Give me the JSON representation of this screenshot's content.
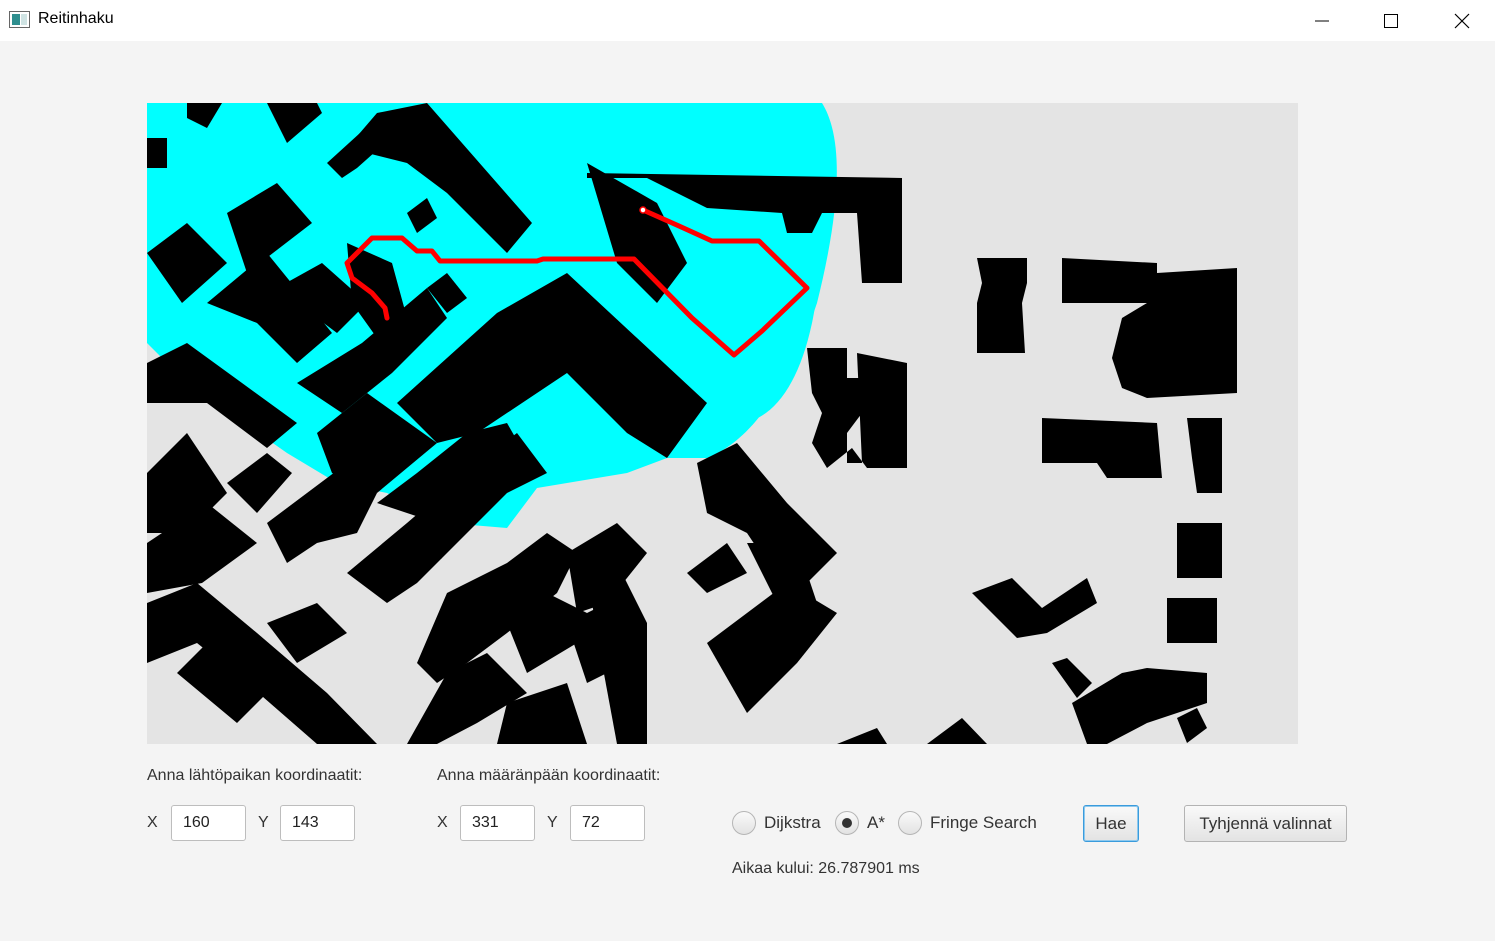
{
  "window": {
    "title": "Reitinhaku"
  },
  "start": {
    "label": "Anna lähtöpaikan koordinaatit:",
    "x_label": "X",
    "x_value": "160",
    "y_label": "Y",
    "y_value": "143"
  },
  "goal": {
    "label": "Anna määränpään koordinaatit:",
    "x_label": "X",
    "x_value": "331",
    "y_label": "Y",
    "y_value": "72"
  },
  "algorithms": [
    {
      "label": "Dijkstra",
      "selected": false
    },
    {
      "label": "A*",
      "selected": true
    },
    {
      "label": "Fringe Search",
      "selected": false
    }
  ],
  "buttons": {
    "search": "Hae",
    "clear": "Tyhjennä valinnat"
  },
  "status": "Aikaa kului: 26.787901 ms",
  "colors": {
    "visited": "#00ffff",
    "path": "#ff0000",
    "obstacle": "#000000",
    "free": "#e4e4e4"
  }
}
